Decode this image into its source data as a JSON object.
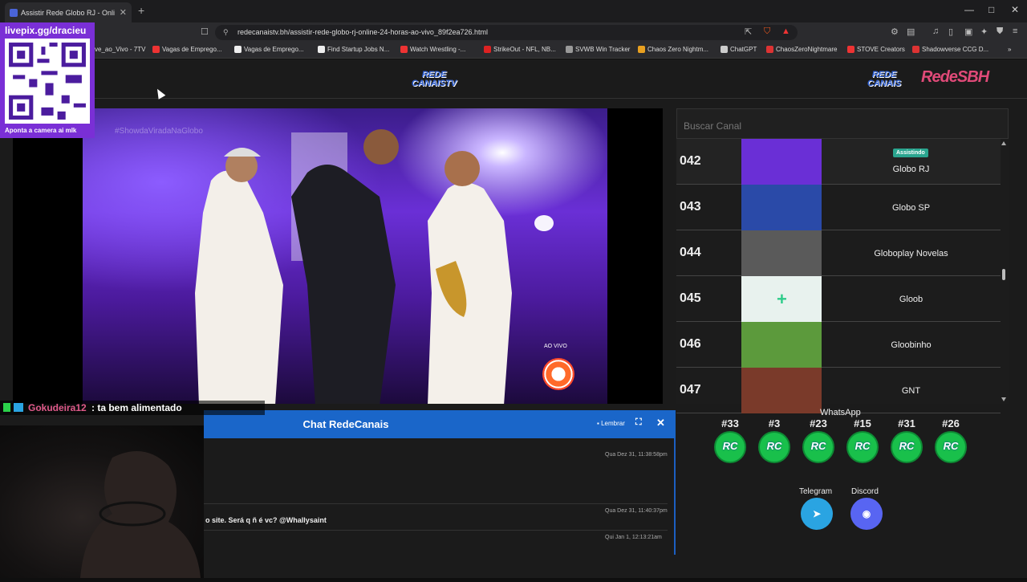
{
  "browser": {
    "tab_title": "Assistir Rede Globo RJ - Onli",
    "url": "redecanaistv.bh/assistir-rede-globo-rj-online-24-horas-ao-vivo_89f2ea726.html",
    "bookmarks": [
      {
        "label": "ve_ao_Vivo - 7TV",
        "color": "#888"
      },
      {
        "label": "Vagas de Emprego...",
        "color": "#e33"
      },
      {
        "label": "Vagas de Emprego...",
        "color": "#eee"
      },
      {
        "label": "Find Startup Jobs N...",
        "color": "#eee"
      },
      {
        "label": "Watch Wrestling -...",
        "color": "#e33"
      },
      {
        "label": "StrikeOut - NFL, NB...",
        "color": "#d22"
      },
      {
        "label": "SVWB Win Tracker",
        "color": "#999"
      },
      {
        "label": "Chaos Zero Nightm...",
        "color": "#e8a020"
      },
      {
        "label": "ChatGPT",
        "color": "#ccc"
      },
      {
        "label": "ChaosZeroNightmare",
        "color": "#d33"
      },
      {
        "label": "STOVE Creators",
        "color": "#e33"
      },
      {
        "label": "Shadowverse CCG D...",
        "color": "#d33"
      }
    ]
  },
  "header": {
    "logo_center": "REDE CANAISTV",
    "logo_right_1": "REDE CANAIS",
    "logo_right_2": "RedeSBH"
  },
  "video": {
    "hashtag": "#ShowdaViradaNaGlobo",
    "live_label": "AO VIVO"
  },
  "channels": {
    "search_placeholder": "Buscar Canal",
    "watching_badge": "Assistindo",
    "items": [
      {
        "number": "042",
        "name": "Globo RJ",
        "active": true,
        "thumb": "#6a2fd6"
      },
      {
        "number": "043",
        "name": "Globo SP",
        "active": false,
        "thumb": "#2a4aa8"
      },
      {
        "number": "044",
        "name": "Globoplay Novelas",
        "active": false,
        "thumb": "#5a5a5a"
      },
      {
        "number": "045",
        "name": "Gloob",
        "active": false,
        "thumb": "#e8f2ee"
      },
      {
        "number": "046",
        "name": "Gloobinho",
        "active": false,
        "thumb": "#5c9a3c"
      },
      {
        "number": "047",
        "name": "GNT",
        "active": false,
        "thumb": "#7a3a2a"
      }
    ]
  },
  "chat": {
    "title": "Chat RedeCanais",
    "remember_label": "Lembrar",
    "messages": [
      {
        "time": "Qua Dez 31, 11:38:58pm",
        "text": ""
      },
      {
        "time": "Qua Dez 31, 11:40:37pm",
        "text": "o site. Será q ñ é vc? @Whallysaint"
      },
      {
        "time": "Qui Jan 1, 12:13:21am",
        "text": ""
      }
    ]
  },
  "social": {
    "whatsapp_title": "WhatsApp",
    "whatsapp_groups": [
      "#33",
      "#3",
      "#23",
      "#15",
      "#31",
      "#26"
    ],
    "whatsapp_icon_label": "RC",
    "telegram_label": "Telegram",
    "discord_label": "Discord",
    "telegram_color": "#2aa4e2",
    "discord_color": "#5865f2"
  },
  "overlay": {
    "qr_url": "livepix.gg/dracieu",
    "qr_caption": "Aponta a camera ai mlk",
    "chat_user": "Gokudeira12",
    "chat_message": ": ta bem alimentado"
  }
}
